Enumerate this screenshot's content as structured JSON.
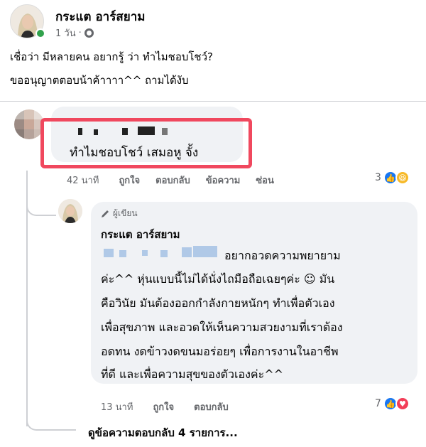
{
  "post": {
    "author": "กระแต อาร์สยาม",
    "time": "1 วัน",
    "dot": "·",
    "lines": [
      "เชื่อว่า มีหลายคน อยากรู้ ว่า ทำไมชอบโชว์?",
      "ขออนุญาตตอบน้าค้าาาา^^ ถามได้งับ"
    ]
  },
  "comment1": {
    "text": "ทำไมชอบโชว์  เสมอหู จั้ง",
    "time": "42 นาที",
    "actions": [
      "ถูกใจ",
      "ตอบกลับ",
      "ข้อความ",
      "ซ่อน"
    ],
    "reaction_count": "3",
    "reactions": [
      "like-icon",
      "haha-icon"
    ]
  },
  "reply": {
    "badge": "ผู้เขียน",
    "author": "กระแต อาร์สยาม",
    "lines": [
      "อยากอวดความพยายาม",
      "ค่ะ^^ หุ่นแบบนี้ไม่ได้นั่งไถมือถือเฉยๆค่ะ ☺ มัน",
      "คือวินัย มันต้องออกกำลังกายหนักๆ  ทำเพื่อตัวเอง",
      "เพื่อสุขภาพ และอวดให้เห็นความสวยงามที่เราต้อง",
      "อดทน งดข้าวงดขนมอร่อยๆ  เพื่อการงานในอาชีพ",
      "ที่ดี และเพื่อความสุขของตัวเองค่ะ^^"
    ],
    "time": "13 นาที",
    "actions": [
      "ถูกใจ",
      "ตอบกลับ"
    ],
    "reaction_count": "7",
    "reactions": [
      "like-icon",
      "love-icon"
    ]
  },
  "view_more": "ดูข้อความตอบกลับ 4 รายการ...",
  "colors": {
    "highlight": "#f0485e",
    "like": "#1877f2",
    "love": "#f33e58",
    "online": "#31a24c",
    "bubble": "#f0f2f5"
  }
}
